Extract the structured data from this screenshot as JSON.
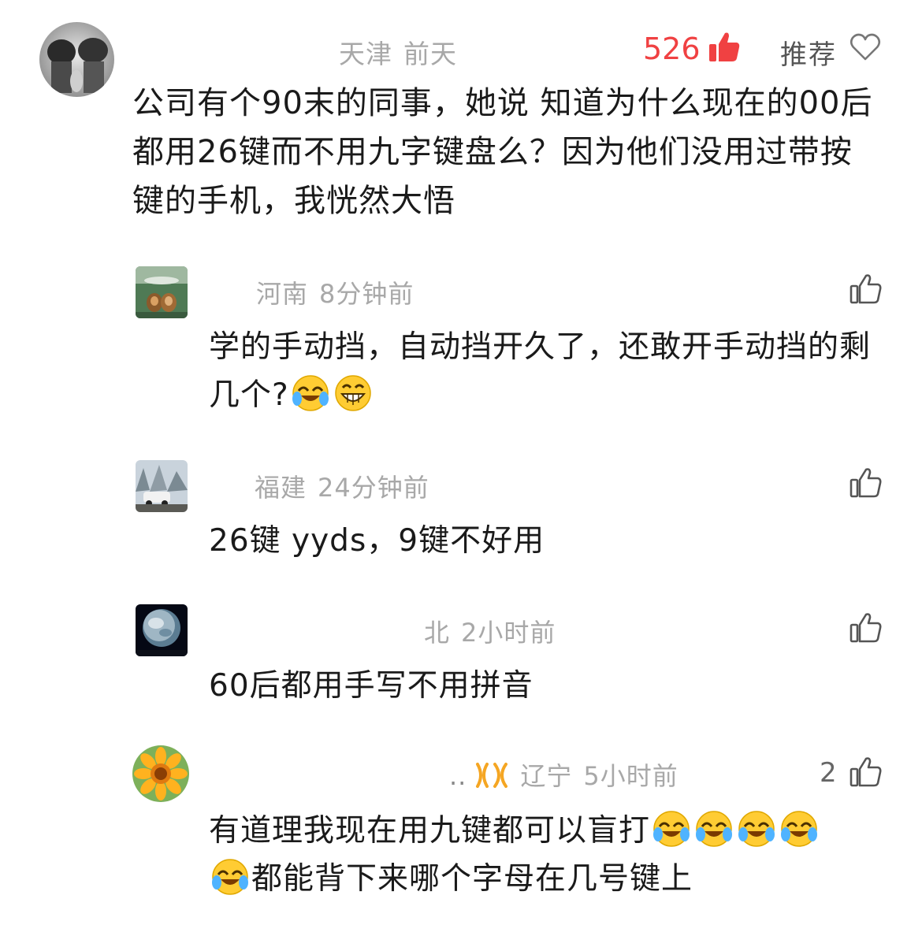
{
  "main_comment": {
    "location": "天津",
    "time": "前天",
    "like_count": "526",
    "recommend_label": "推荐",
    "text": "公司有个90末的同事，她说 知道为什么现在的00后都用26键而不用九字键盘么？因为他们没用过带按键的手机，我恍然大悟"
  },
  "replies": [
    {
      "location": "河南",
      "time": "8分钟前",
      "text": "学的手动挡，自动挡开久了，还敢开手动挡的剩几个?"
    },
    {
      "location": "福建",
      "time": "24分钟前",
      "text": "26键 yyds，9键不好用"
    },
    {
      "location": "北",
      "time": "2小时前",
      "text": "60后都用手写不用拼音"
    },
    {
      "name_fragment": "..",
      "location": "辽宁",
      "time": "5小时前",
      "like_count": "2",
      "text_line1": "有道理我现在用九键都可以盲打",
      "text_line2": "都能背下来哪个字母在几号键上"
    }
  ],
  "colors": {
    "accent_red": "#f04142",
    "meta_gray": "#a8a8a8",
    "text": "#1a1a1a",
    "vip_badge": "#f5a623"
  }
}
